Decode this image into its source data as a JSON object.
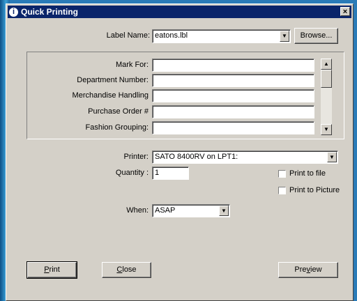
{
  "window": {
    "title": "Quick Printing",
    "close_glyph": "×"
  },
  "label": {
    "caption": "Label Name:",
    "value": "eatons.lbl",
    "browse": "Browse..."
  },
  "fields": [
    {
      "label": "Mark For:",
      "value": ""
    },
    {
      "label": "Department Number:",
      "value": ""
    },
    {
      "label": "Merchandise Handling",
      "value": ""
    },
    {
      "label": "Purchase Order #",
      "value": ""
    },
    {
      "label": "Fashion Grouping:",
      "value": ""
    }
  ],
  "printer": {
    "caption": "Printer:",
    "value": "SATO 8400RV on LPT1:"
  },
  "quantity": {
    "caption": "Quantity :",
    "value": "1"
  },
  "options": {
    "print_to_file": "Print to file",
    "print_to_picture": "Print to Picture",
    "print_to_file_checked": false,
    "print_to_picture_checked": false
  },
  "when": {
    "caption": "When:",
    "value": "ASAP"
  },
  "buttons": {
    "print": {
      "mnemonic": "P",
      "rest": "rint"
    },
    "close": {
      "mnemonic": "C",
      "rest": "lose"
    },
    "preview": {
      "pre": "Pre",
      "mnemonic": "v",
      "rest": "iew"
    }
  },
  "icons": {
    "app": "info-icon",
    "arrow": "▼",
    "up": "▲"
  }
}
